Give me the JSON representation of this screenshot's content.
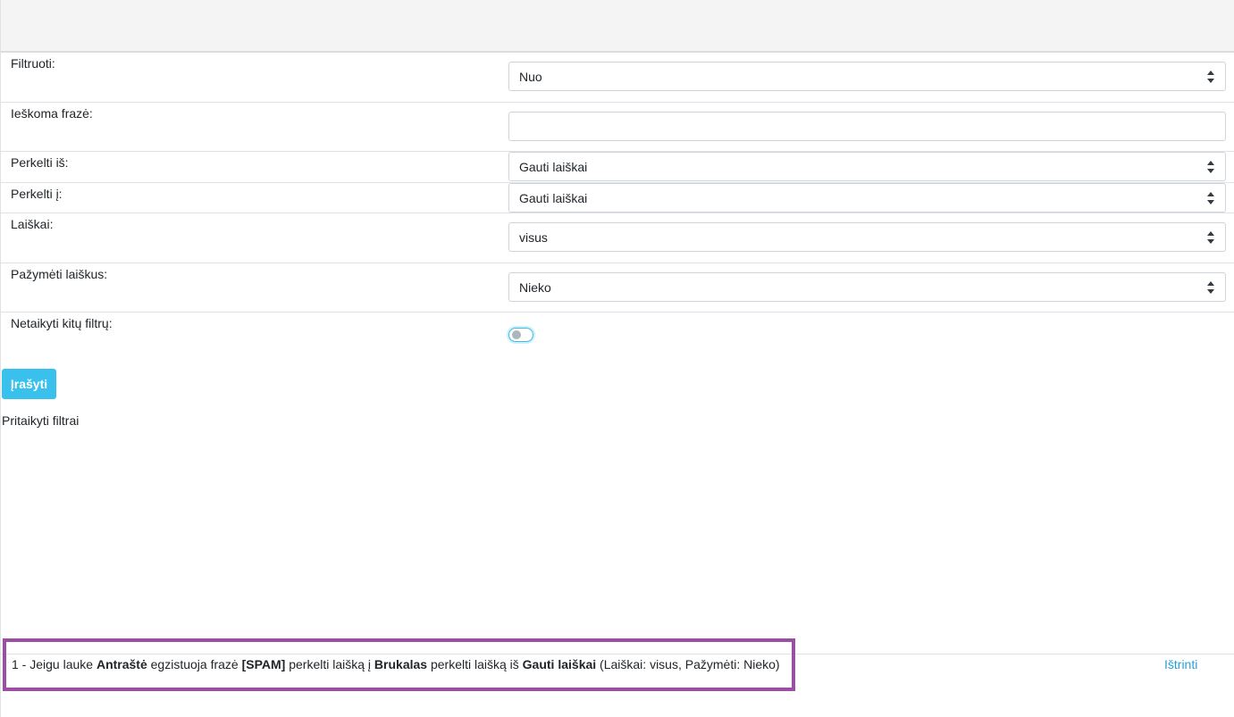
{
  "form": {
    "filter": {
      "label": "Filtruoti:",
      "value": "Nuo"
    },
    "search_phrase": {
      "label": "Ieškoma frazė:",
      "value": ""
    },
    "move_from": {
      "label": "Perkelti iš:",
      "value": "Gauti laiškai"
    },
    "move_to": {
      "label": "Perkelti į:",
      "value": "Gauti laiškai"
    },
    "messages": {
      "label": "Laiškai:",
      "value": "visus"
    },
    "mark_messages": {
      "label": "Pažymėti laiškus:",
      "value": "Nieko"
    },
    "no_other_filters": {
      "label": "Netaikyti kitų filtrų:",
      "checked": false
    }
  },
  "save_label": "Įrašyti",
  "applied": {
    "title": "Pritaikyti filtrai",
    "items": [
      {
        "prefix": "1 - Jeigu lauke ",
        "field": "Antraštė",
        "mid1": " egzistuoja frazė ",
        "phrase": "[SPAM]",
        "mid2": " perkelti laišką į ",
        "target": "Brukalas",
        "mid3": " perkelti laišką iš ",
        "source": "Gauti laiškai",
        "suffix": " (Laiškai: visus, Pažymėti: Nieko)",
        "delete_label": "Ištrinti"
      }
    ]
  },
  "colors": {
    "accent": "#39c0ed",
    "link": "#2a9fd6",
    "highlight": "#9b4fa4"
  }
}
